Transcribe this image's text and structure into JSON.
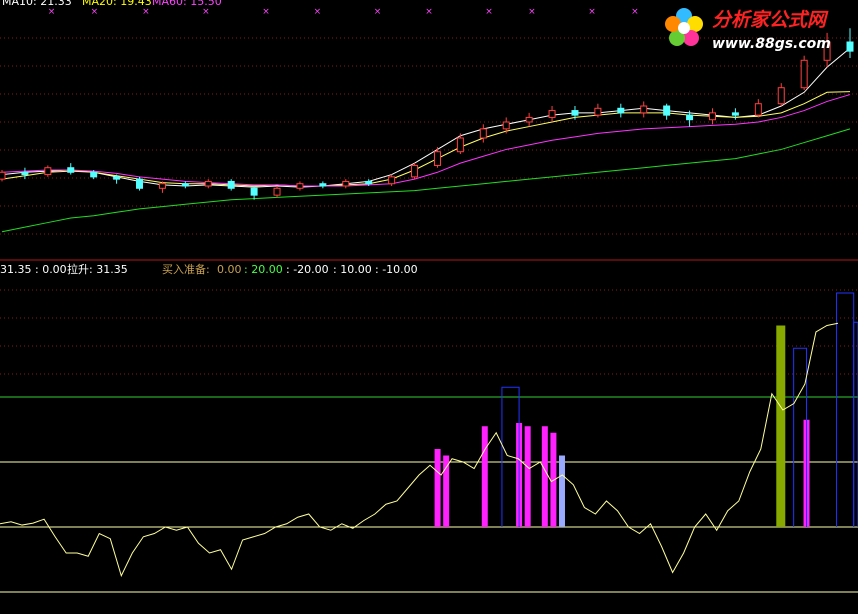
{
  "colors": {
    "background": "#000000",
    "grid_dotted": "#8b1a1a",
    "separator": "#b01818",
    "candle_up": "#ff4040",
    "candle_down": "#54ffff",
    "ma_short": "#ffffff",
    "ma_mid": "#ffff66",
    "ma_long": "#ff33ff",
    "ma_longer": "#22dd22",
    "osc_line": "#ffff99",
    "hline_green": "#33cc33",
    "hline_yellow": "#ffffaa",
    "bar_magenta": "#ff22ff",
    "bar_olive": "#88aa00",
    "bar_lightblue": "#99aaff",
    "bar_blue_outline": "#2233ff",
    "cross_marker": "#ff44ff",
    "legend_ma10": "#ffffff",
    "legend_ma20": "#ffff00",
    "legend_ma60": "#ff44ff",
    "lower_legend": "#ffffff",
    "lower_legend_title": "#c8a050",
    "lower_legend_green": "#44ff44"
  },
  "top_legend": {
    "ma10": "MA10: 21.33",
    "ma20": "MA20: 19.43",
    "ma60": "MA60: 15.50"
  },
  "lower_legend": {
    "part1": "31.35 : 0.00",
    "part2": "拉升: 31.35",
    "title": "买入准备:",
    "v1": "0.00",
    "v2": ": 20.00",
    "v3": ": -20.00",
    "v4": ": 10.00",
    "v5": ": -10.00"
  },
  "logo": {
    "name": "分析家公式网",
    "url": "www.88gs.com"
  },
  "chart_data": {
    "type": "line",
    "upper_panel": {
      "series": [
        {
          "name": "MA10",
          "values": [
            15.8,
            15.9,
            15.95,
            16.0,
            15.9,
            15.7,
            15.5,
            15.35,
            15.3,
            15.35,
            15.3,
            15.25,
            15.3,
            15.25,
            15.3,
            15.4,
            15.5,
            15.8,
            16.3,
            16.9,
            17.5,
            17.8,
            18.0,
            18.2,
            18.4,
            18.5,
            18.5,
            18.6,
            18.7,
            18.6,
            18.5,
            18.4,
            18.3,
            18.4,
            18.8,
            19.4,
            20.5,
            21.33
          ]
        },
        {
          "name": "MA20",
          "values": [
            15.6,
            15.75,
            15.9,
            15.95,
            15.9,
            15.75,
            15.6,
            15.45,
            15.4,
            15.4,
            15.35,
            15.3,
            15.35,
            15.3,
            15.3,
            15.35,
            15.4,
            15.6,
            16.0,
            16.5,
            17.0,
            17.4,
            17.7,
            17.9,
            18.1,
            18.3,
            18.4,
            18.5,
            18.5,
            18.5,
            18.4,
            18.35,
            18.3,
            18.35,
            18.5,
            18.9,
            19.4,
            19.43
          ]
        },
        {
          "name": "MA60",
          "values": [
            15.9,
            15.95,
            16.0,
            16.0,
            15.95,
            15.85,
            15.7,
            15.6,
            15.5,
            15.45,
            15.4,
            15.35,
            15.35,
            15.3,
            15.3,
            15.3,
            15.35,
            15.4,
            15.6,
            15.9,
            16.3,
            16.6,
            16.9,
            17.1,
            17.3,
            17.45,
            17.6,
            17.7,
            17.8,
            17.85,
            17.9,
            17.95,
            18.0,
            18.1,
            18.3,
            18.6,
            19.0,
            15.5
          ]
        },
        {
          "name": "",
          "values": [
            13.3,
            13.5,
            13.7,
            13.9,
            14.0,
            14.15,
            14.3,
            14.4,
            14.5,
            14.6,
            14.7,
            14.75,
            14.8,
            14.85,
            14.9,
            14.95,
            15.0,
            15.05,
            15.1,
            15.2,
            15.3,
            15.4,
            15.5,
            15.6,
            15.7,
            15.8,
            15.9,
            16.0,
            16.1,
            16.2,
            16.3,
            16.4,
            16.5,
            16.7,
            16.9,
            17.2,
            17.5,
            17.8
          ]
        }
      ],
      "candles_approx": [
        [
          15.6,
          15.9,
          15.5,
          16.0
        ],
        [
          15.9,
          15.8,
          15.6,
          16.1
        ],
        [
          15.8,
          16.1,
          15.7,
          16.2
        ],
        [
          16.1,
          15.9,
          15.8,
          16.3
        ],
        [
          15.9,
          15.7,
          15.6,
          16.0
        ],
        [
          15.7,
          15.6,
          15.4,
          15.8
        ],
        [
          15.6,
          15.2,
          15.1,
          15.7
        ],
        [
          15.2,
          15.4,
          15.0,
          15.5
        ],
        [
          15.4,
          15.3,
          15.2,
          15.5
        ],
        [
          15.3,
          15.5,
          15.2,
          15.6
        ],
        [
          15.5,
          15.2,
          15.1,
          15.6
        ],
        [
          15.2,
          14.9,
          14.7,
          15.3
        ],
        [
          14.9,
          15.2,
          14.8,
          15.3
        ],
        [
          15.2,
          15.4,
          15.1,
          15.5
        ],
        [
          15.4,
          15.3,
          15.2,
          15.5
        ],
        [
          15.3,
          15.5,
          15.2,
          15.6
        ],
        [
          15.5,
          15.4,
          15.3,
          15.6
        ],
        [
          15.4,
          15.7,
          15.3,
          15.8
        ],
        [
          15.7,
          16.2,
          15.6,
          16.3
        ],
        [
          16.2,
          16.8,
          16.1,
          17.0
        ],
        [
          16.8,
          17.4,
          16.7,
          17.6
        ],
        [
          17.4,
          17.8,
          17.2,
          18.0
        ],
        [
          17.8,
          18.1,
          17.6,
          18.3
        ],
        [
          18.1,
          18.3,
          17.9,
          18.5
        ],
        [
          18.3,
          18.6,
          18.1,
          18.8
        ],
        [
          18.6,
          18.4,
          18.2,
          18.8
        ],
        [
          18.4,
          18.7,
          18.3,
          18.9
        ],
        [
          18.7,
          18.5,
          18.3,
          18.9
        ],
        [
          18.5,
          18.8,
          18.3,
          19.0
        ],
        [
          18.8,
          18.4,
          18.2,
          18.9
        ],
        [
          18.4,
          18.2,
          17.9,
          18.6
        ],
        [
          18.2,
          18.5,
          18.0,
          18.7
        ],
        [
          18.5,
          18.4,
          18.2,
          18.7
        ],
        [
          18.4,
          18.9,
          18.3,
          19.1
        ],
        [
          18.9,
          19.6,
          18.8,
          19.8
        ],
        [
          19.6,
          20.8,
          19.5,
          21.0
        ],
        [
          20.8,
          21.6,
          20.5,
          22.0
        ],
        [
          21.6,
          21.2,
          20.9,
          22.2
        ]
      ]
    },
    "lower_panel": {
      "name": "拉升",
      "reference_lines": [
        20,
        10,
        0,
        -10
      ],
      "ylim": [
        -12,
        38
      ],
      "osc_values": [
        0.5,
        0.8,
        0.3,
        0.6,
        1.2,
        -1.5,
        -4.0,
        -4.0,
        -4.5,
        -1.0,
        -1.8,
        -7.5,
        -4.0,
        -1.5,
        -1.0,
        0.0,
        -0.5,
        0.0,
        -2.5,
        -4.0,
        -3.5,
        -6.5,
        -2.0,
        -1.5,
        -1.0,
        0.0,
        0.5,
        1.5,
        2.0,
        0.0,
        -0.5,
        0.5,
        -0.2,
        1.0,
        2.0,
        3.5,
        4.0,
        6.0,
        8.0,
        9.5,
        8.0,
        10.5,
        10.0,
        9.0,
        12.0,
        14.5,
        11.0,
        10.5,
        9.0,
        10.0,
        7.0,
        8.0,
        6.5,
        3.0,
        2.0,
        4.0,
        2.5,
        0.0,
        -1.0,
        0.5,
        -3.0,
        -7.0,
        -4.0,
        0.0,
        2.0,
        -0.5,
        2.5,
        4.0,
        8.5,
        12.0,
        20.5,
        18.0,
        19.0,
        22.0,
        30.0,
        31.0,
        31.35
      ],
      "bars": [
        {
          "x": 0.51,
          "value": 12.0,
          "color": "bar_magenta"
        },
        {
          "x": 0.52,
          "value": 11.0,
          "color": "bar_magenta"
        },
        {
          "x": 0.565,
          "value": 15.5,
          "color": "bar_magenta"
        },
        {
          "x": 0.605,
          "value": 16.0,
          "color": "bar_magenta"
        },
        {
          "x": 0.615,
          "value": 15.5,
          "color": "bar_magenta"
        },
        {
          "x": 0.635,
          "value": 15.5,
          "color": "bar_magenta"
        },
        {
          "x": 0.645,
          "value": 14.5,
          "color": "bar_magenta"
        },
        {
          "x": 0.655,
          "value": 11.0,
          "color": "bar_lightblue"
        },
        {
          "x": 0.91,
          "value": 31.0,
          "color": "bar_olive"
        },
        {
          "x": 0.94,
          "value": 16.5,
          "color": "bar_magenta"
        }
      ],
      "blue_boxes": [
        {
          "x0": 0.585,
          "x1": 0.605,
          "value": 21.5
        },
        {
          "x0": 0.925,
          "x1": 0.94,
          "value": 27.5
        },
        {
          "x0": 0.975,
          "x1": 0.995,
          "value": 36.0
        },
        {
          "x0": 0.995,
          "x1": 1.0,
          "value": 31.5
        }
      ],
      "markers_top": [
        0.06,
        0.11,
        0.17,
        0.24,
        0.31,
        0.37,
        0.44,
        0.5,
        0.57,
        0.62,
        0.69,
        0.74
      ]
    }
  }
}
